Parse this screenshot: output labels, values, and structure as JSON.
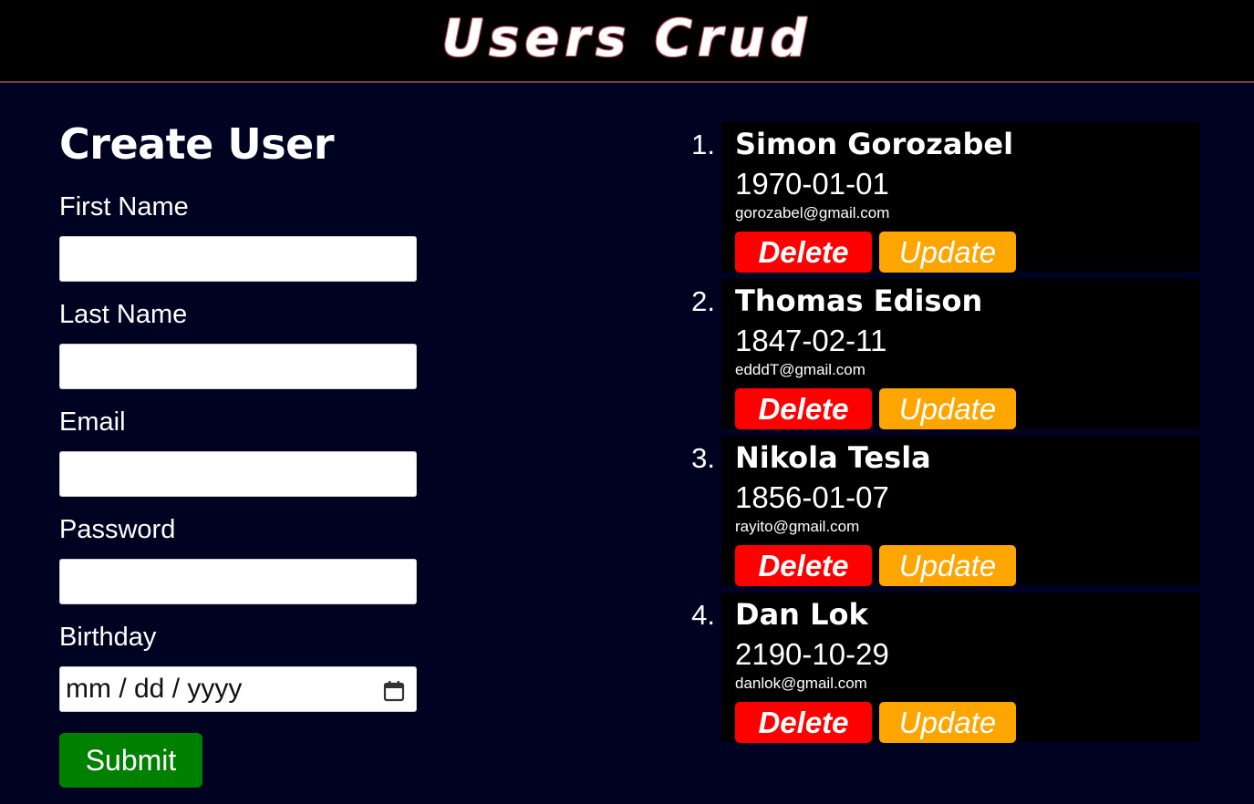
{
  "app": {
    "title": "Users Crud"
  },
  "form": {
    "title": "Create User",
    "first_name_label": "First Name",
    "last_name_label": "Last Name",
    "email_label": "Email",
    "password_label": "Password",
    "birthday_label": "Birthday",
    "birthday_placeholder": "mm / dd / yyyy",
    "submit_label": "Submit"
  },
  "users": [
    {
      "number": "1.",
      "name": "Simon Gorozabel",
      "birthday": "1970-01-01",
      "email": "gorozabel@gmail.com",
      "delete_label": "Delete",
      "update_label": "Update"
    },
    {
      "number": "2.",
      "name": "Thomas Edison",
      "birthday": "1847-02-11",
      "email": "edddT@gmail.com",
      "delete_label": "Delete",
      "update_label": "Update"
    },
    {
      "number": "3.",
      "name": "Nikola Tesla",
      "birthday": "1856-01-07",
      "email": "rayito@gmail.com",
      "delete_label": "Delete",
      "update_label": "Update"
    },
    {
      "number": "4.",
      "name": "Dan Lok",
      "birthday": "2190-10-29",
      "email": "danlok@gmail.com",
      "delete_label": "Delete",
      "update_label": "Update"
    }
  ],
  "colors": {
    "background": "#000222",
    "header": "#000000",
    "delete": "#ff0000",
    "update": "#ffa500",
    "submit": "#008000"
  },
  "icons": {
    "date_picker": "calendar-icon"
  }
}
